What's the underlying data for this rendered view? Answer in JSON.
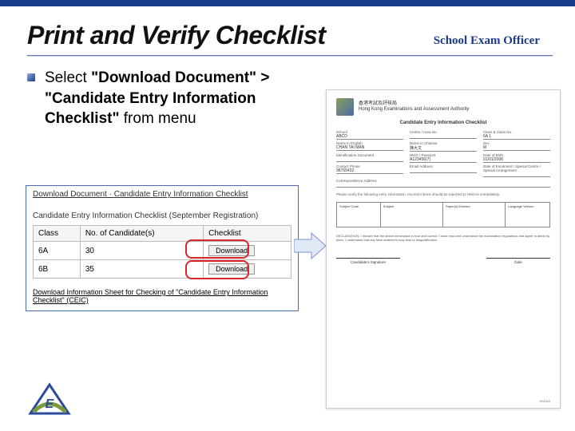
{
  "header": {
    "title": "Print and Verify Checklist",
    "role": "School Exam Officer"
  },
  "bullet": {
    "prefix": "Select ",
    "strong": "\"Download Document\" > \"Candidate Entry Information Checklist\"",
    "suffix": " from menu"
  },
  "panel": {
    "breadcrumb_a": "Download Document",
    "breadcrumb_sep": " · ",
    "breadcrumb_b": "Candidate Entry Information Checklist",
    "subtitle": "Candidate Entry Information Checklist (September Registration)",
    "cols": {
      "class": "Class",
      "count": "No. of Candidate(s)",
      "checklist": "Checklist"
    },
    "rows": [
      {
        "class": "6A",
        "count": "30",
        "btn": "Download"
      },
      {
        "class": "6B",
        "count": "35",
        "btn": "Download"
      }
    ],
    "info_link": "Download Information Sheet for Checking of \"Candidate Entry Information Checklist\" (CEIC)"
  },
  "doc": {
    "org_zh": "香港考試及評核局",
    "org_en": "Hong Kong Examinations and Assessment Authority",
    "title": "Candidate Entry Information Checklist",
    "labels": {
      "school": "School",
      "centre": "Centre / Area No.",
      "name_en": "Name in English",
      "name_cn": "Name in Chinese",
      "id": "Identification Document",
      "hkid": "HKID / Passport",
      "dob": "Date of Birth",
      "sex": "Sex",
      "email": "Email Address",
      "phone": "Contact Phone",
      "addr": "Correspondence Address",
      "class": "Class & Class No.",
      "sen": "Date of Enrolment / Special Centre / Special Arrangement"
    },
    "values": {
      "school": "ABCD",
      "class": "6A  1",
      "name_en": "CHAN TAI MAN",
      "name_cn": "陳大文",
      "hkid": "A123456(7)",
      "dob": "01/01/2006",
      "sex": "M",
      "phone": "98765432"
    },
    "note": "Please verify the following entry information. Incorrect items should be reported to HKEAA immediately.",
    "subjects_head": [
      "Subject Code",
      "Subject",
      "Paper(s) Entered",
      "Language Version"
    ],
    "decl": "DECLARATION: I declare that the above information is true and correct. I have read and understood the examination regulations and agree to abide by them. I understand that any false statement may lead to disqualification.",
    "sign_candidate": "Candidate's Signature",
    "sign_date": "Date",
    "foot": "HKEAA"
  }
}
